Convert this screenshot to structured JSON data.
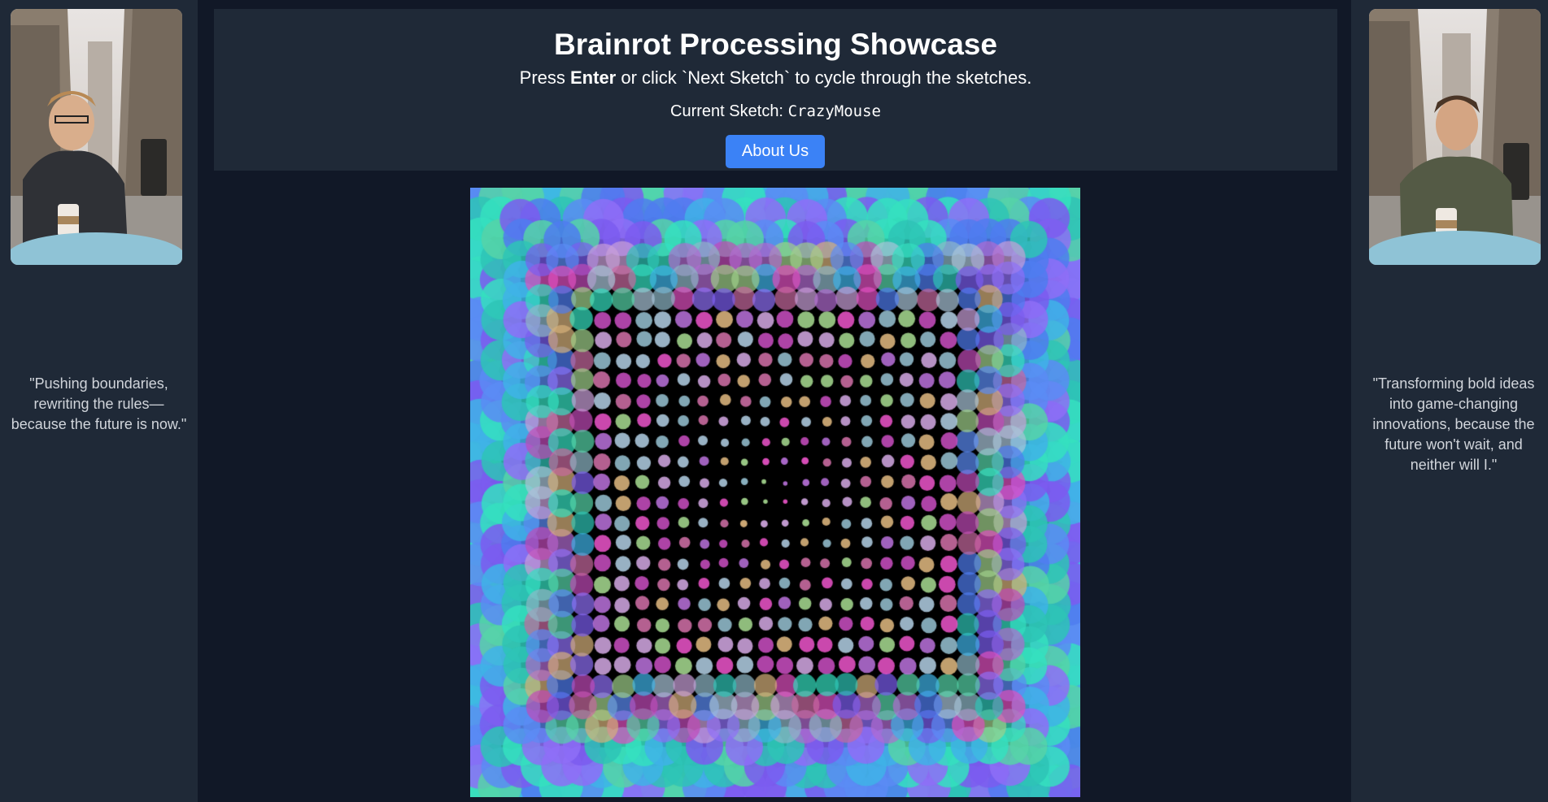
{
  "header": {
    "title": "Brainrot Processing Showcase",
    "instructions_prefix": "Press ",
    "instructions_key": "Enter",
    "instructions_suffix": " or click `Next Sketch` to cycle through the sketches.",
    "current_label": "Current Sketch: ",
    "current_sketch": "CrazyMouse",
    "about_button": "About Us"
  },
  "left_panel": {
    "quote": "\"Pushing boundaries, rewriting the rules—because the future is now.\""
  },
  "right_panel": {
    "quote": "\"Transforming bold ideas into game-changing innovations, because the future won't wait, and neither will I.\""
  },
  "colors": {
    "page_bg": "#111827",
    "panel_bg": "#1f2937",
    "accent": "#3b82f6",
    "quote_text": "#d1d5db"
  }
}
